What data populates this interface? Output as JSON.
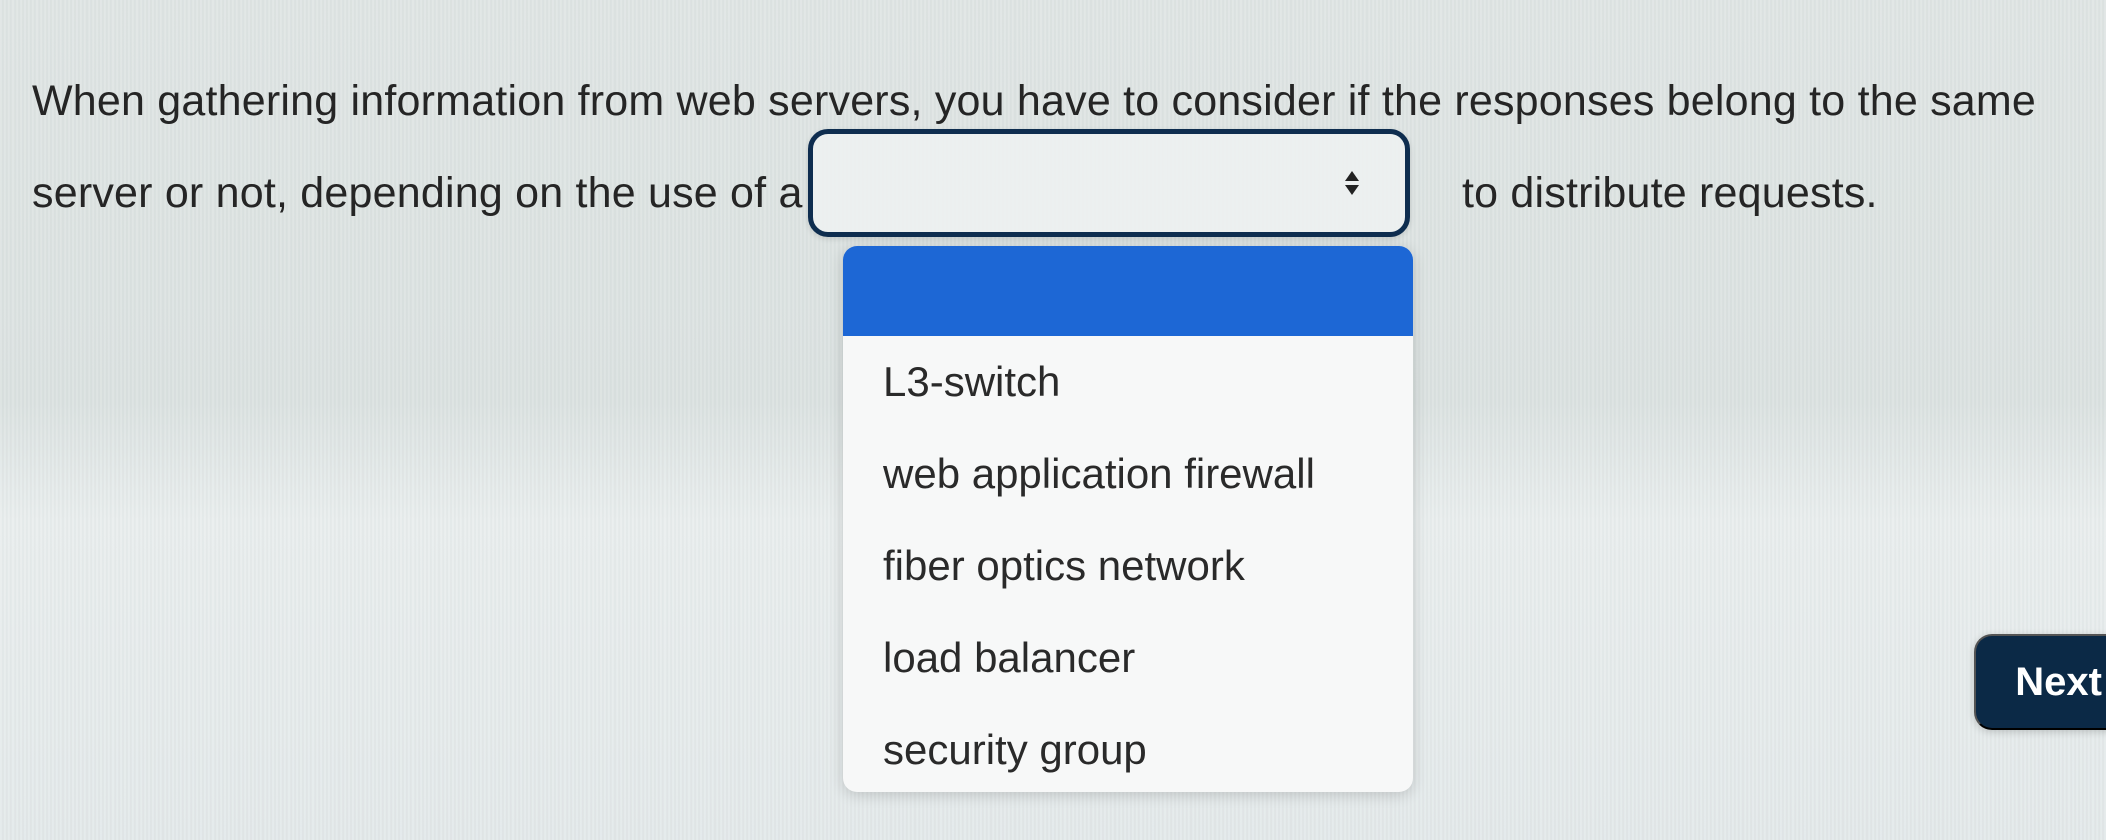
{
  "question": {
    "line1": "When gathering information from web servers, you have to consider if the responses belong to the same",
    "line2_before": "server or not, depending on the use of a",
    "line2_after": "to distribute requests."
  },
  "select": {
    "value": "",
    "icon": "up-down-chevron-icon"
  },
  "dropdown": {
    "options": [
      "",
      "L3-switch",
      "web application firewall",
      "fiber optics network",
      "load balancer",
      "security group"
    ]
  },
  "buttons": {
    "next_label": "Next"
  },
  "colors": {
    "selected_option": "#1d67d5",
    "select_border": "#0e2d4f",
    "next_button": "#0b2946"
  }
}
